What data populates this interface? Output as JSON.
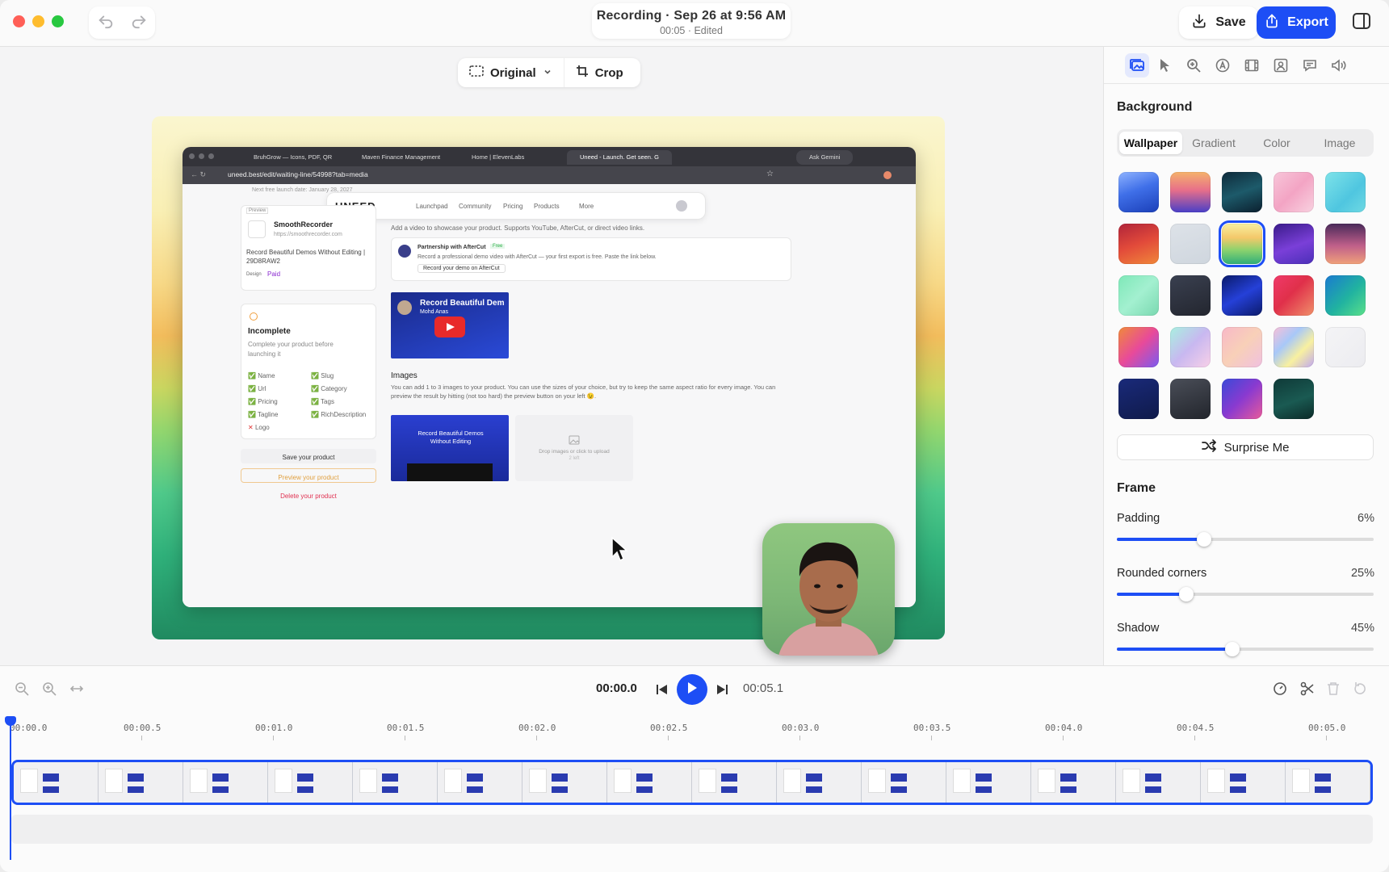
{
  "window": {
    "title": "Recording · Sep 26 at 9:56 AM",
    "subtitle": "00:05 · Edited",
    "save_label": "Save",
    "export_label": "Export"
  },
  "toolbar": {
    "aspect_label": "Original",
    "crop_label": "Crop"
  },
  "browser": {
    "tabs": [
      "BruhGrow — Icons, PDF, QR",
      "Maven Finance Management",
      "Home | ElevenLabs",
      "Uneed - Launch. Get seen. G"
    ],
    "ask_label": "Ask Gemini",
    "url": "uneed.best/edit/waiting-line/54998?tab=media",
    "nav": {
      "logo": "UNEED",
      "links": [
        "Launchpad",
        "Community",
        "Pricing",
        "Products",
        "More"
      ]
    },
    "launch_date": "Next free launch date: January 28, 2027",
    "preview_badge": "Preview",
    "product_name": "SmoothRecorder",
    "product_url": "https://smoothrecorder.com",
    "product_tagline": "Record Beautiful Demos Without Editing | 29D8RAW2",
    "tag_design": "Design",
    "tag_paid": "Paid",
    "incomplete_title": "Incomplete",
    "incomplete_desc": "Complete your product before launching it",
    "checklist_left": [
      "Name",
      "Url",
      "Pricing",
      "Tagline",
      "Logo"
    ],
    "checklist_right": [
      "Slug",
      "Category",
      "Tags",
      "RichDescription"
    ],
    "save_product": "Save your product",
    "preview_product": "Preview your product",
    "delete_product": "Delete your product",
    "video_hint": "Add a video to showcase your product. Supports YouTube, AfterCut, or direct video links.",
    "partner_title": "Partnership with AfterCut",
    "partner_badge": "Free",
    "partner_desc": "Record a professional demo video with AfterCut — your first export is free. Paste the link below.",
    "partner_btn": "Record your demo on AfterCut",
    "video_title": "Record Beautiful Dem",
    "video_author": "Mohd Anas",
    "images_title": "Images",
    "images_desc": "You can add 1 to 3 images to your product. You can use the sizes of your choice, but try to keep the same aspect ratio for every image. You can preview the result by hitting (not too hard) the preview button on your left 😉.",
    "image_card_title": "Record Beautiful Demos Without Editing",
    "upload_hint": "Drop images or click to upload",
    "upload_sub": "2 left"
  },
  "panel": {
    "tools": [
      "background-icon",
      "cursor-icon",
      "zoom-icon",
      "annotation-icon",
      "film-icon",
      "camera-icon",
      "caption-icon",
      "audio-icon"
    ],
    "background_title": "Background",
    "tabs": [
      "Wallpaper",
      "Gradient",
      "Color",
      "Image"
    ],
    "active_tab": "Wallpaper",
    "surprise_label": "Surprise Me",
    "frame_title": "Frame",
    "sliders": [
      {
        "label": "Padding",
        "value": "6%",
        "fraction": 0.34
      },
      {
        "label": "Rounded corners",
        "value": "25%",
        "fraction": 0.27
      },
      {
        "label": "Shadow",
        "value": "45%",
        "fraction": 0.45
      }
    ],
    "swatches": [
      "linear-gradient(160deg,#8fb3ff 0%,#3f6fe8 45%,#1b3fb8 100%)",
      "linear-gradient(180deg,#f5b26b 0%,#e76f8a 45%,#4a3fc7 100%)",
      "linear-gradient(160deg,#0f2b3b 0%,#1d5a6a 50%,#0b1f2e 100%)",
      "linear-gradient(135deg,#f7c6d9 0%,#f3a4c4 50%,#f8d2e0 100%)",
      "linear-gradient(135deg,#7ee3e9 0%,#4fc6e0 60%,#6fd9e3 100%)",
      "linear-gradient(160deg,#b0243a 0%,#e24a3a 50%,#f0873a 100%)",
      "linear-gradient(160deg,#dde2e8 0%,#cfd6de 100%)",
      "linear-gradient(180deg,#f7ef9e 0%,#f4c86a 35%,#8dd26d 65%,#2fae7a 100%)",
      "linear-gradient(160deg,#3a1b8a 0%,#7a3fd8 55%,#4b2fb8 100%)",
      "linear-gradient(180deg,#4a2a5a 0%,#c0608a 55%,#f0a07a 100%)",
      "linear-gradient(135deg,#7ee8b8 0%,#a3f0d0 50%,#7ad8b0 100%)",
      "linear-gradient(160deg,#3a4050 0%,#23262f 100%)",
      "linear-gradient(150deg,#0a1a6a 0%,#2540d8 50%,#0b1a6a 100%)",
      "linear-gradient(135deg,#f03a6a 0%,#e0304a 45%,#f0906a 100%)",
      "linear-gradient(135deg,#1a7ad0 0%,#21b3a0 55%,#5ae08a 100%)",
      "linear-gradient(135deg,#f08a3a 0%,#e84a9a 50%,#7a5af0 100%)",
      "linear-gradient(135deg,#a8f0e0 0%,#c8b8f0 50%,#f8d0e8 100%)",
      "linear-gradient(135deg,#f8b8c8 0%,#f8d0b8 50%,#f0c0e0 100%)",
      "linear-gradient(135deg,#f8c0d8 0%,#a8c8f8 35%,#f8f0a0 65%,#c0a8f0 100%)",
      "linear-gradient(135deg,#f4f4f6 0%,#ececf0 100%)",
      "linear-gradient(160deg,#1a2a7a 0%,#0f1a4a 100%)",
      "linear-gradient(160deg,#4a4e58 0%,#22252c 100%)",
      "linear-gradient(135deg,#3a4ad8 0%,#8a3ad0 50%,#e85a9a 100%)",
      "linear-gradient(160deg,#0f3a38 0%,#1a5a52 55%,#0b2a28 100%)"
    ],
    "selected_swatch": 7
  },
  "timeline": {
    "current": "00:00.0",
    "total": "00:05.1",
    "ticks": [
      "00:00.0",
      "00:00.5",
      "00:01.0",
      "00:01.5",
      "00:02.0",
      "00:02.5",
      "00:03.0",
      "00:03.5",
      "00:04.0",
      "00:04.5",
      "00:05.0"
    ]
  }
}
